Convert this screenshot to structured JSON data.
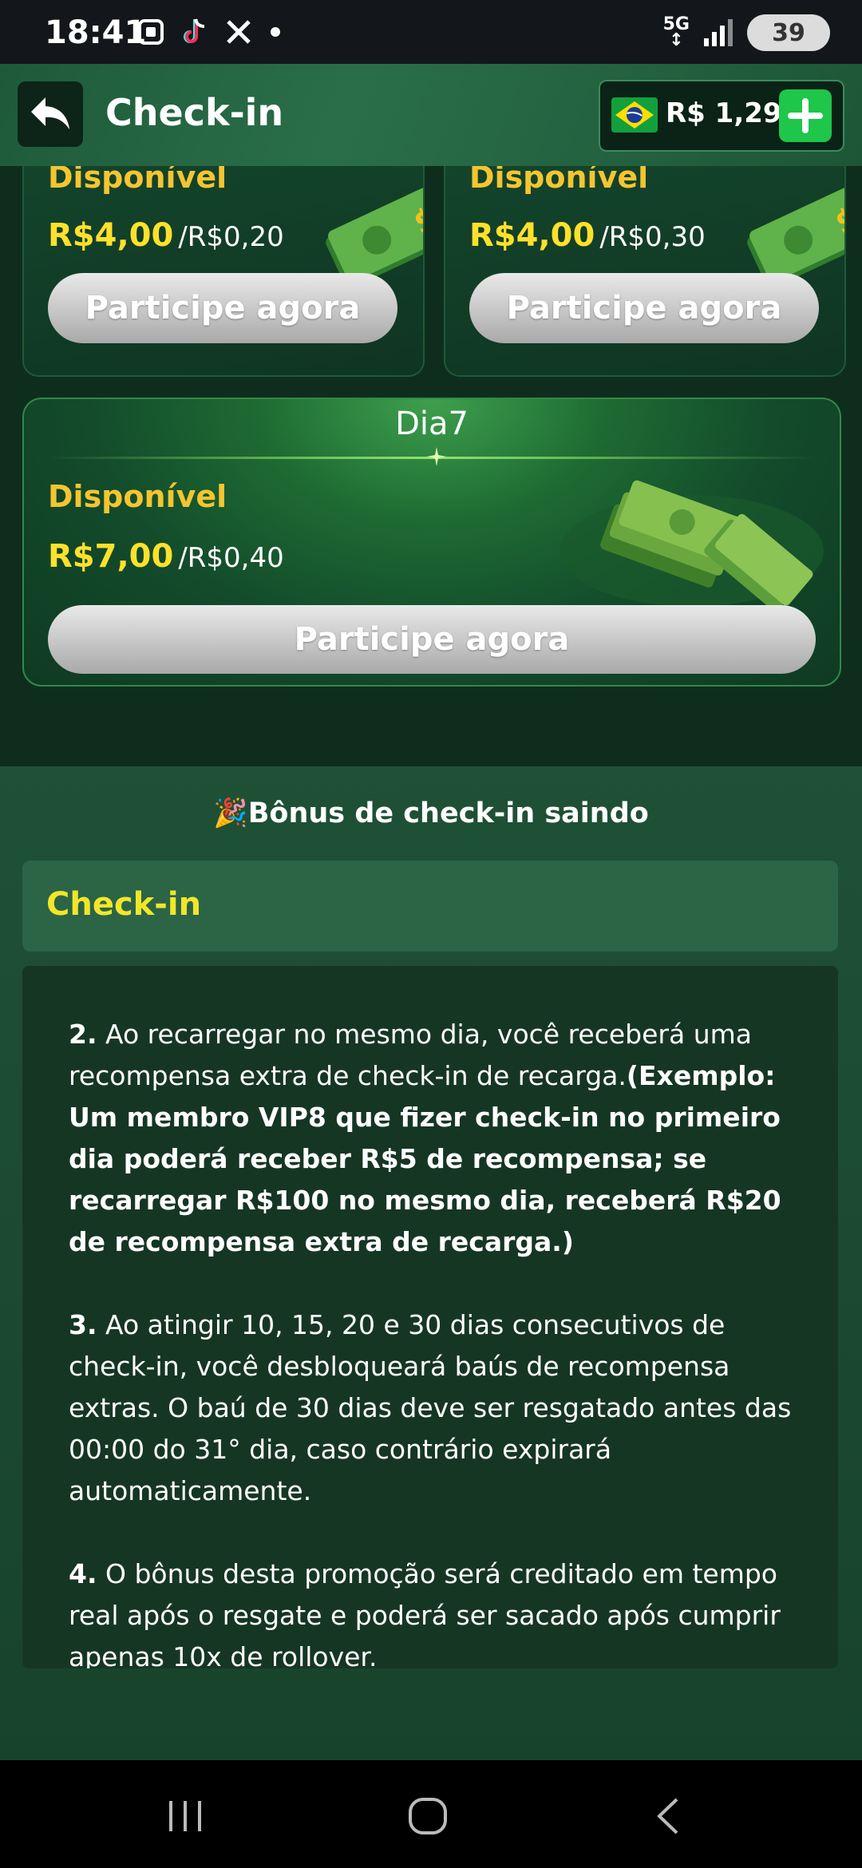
{
  "status_bar": {
    "time": "18:41",
    "network": "5G",
    "battery": "39",
    "left_icons": [
      "screenshot-icon",
      "tiktok-icon",
      "x-icon",
      "dot-icon"
    ]
  },
  "header": {
    "title": "Check-in",
    "back_icon": "back-arrow-icon",
    "wallet_amount": "R$ 1,29",
    "flag_icon": "brazil-flag-icon",
    "add_icon": "plus-icon"
  },
  "cards": {
    "small": [
      {
        "status": "Disponível",
        "amount": "R$4,00",
        "cost": "/R$0,20",
        "button": "Participe agora"
      },
      {
        "status": "Disponível",
        "amount": "R$4,00",
        "cost": "/R$0,30",
        "button": "Participe agora"
      }
    ],
    "day7": {
      "title": "Dia7",
      "status": "Disponível",
      "amount": "R$7,00",
      "cost": "/R$0,40",
      "button": "Participe agora"
    }
  },
  "bonus": {
    "heading": "🎉Bônus de check-in saindo",
    "section_title": "Check-in",
    "rules": {
      "r2_num": "2.",
      "r2_text": " Ao recarregar no mesmo dia, você receberá uma recompensa extra de check-in de recarga.",
      "r2_bold": "(Exemplo: Um membro VIP8 que fizer check-in no primeiro dia poderá receber R$5 de recompensa; se recarregar R$100 no mesmo dia, receberá R$20 de recompensa extra de recarga.)",
      "r3_num": "3.",
      "r3_text": " Ao atingir 10, 15, 20 e 30 dias consecutivos de check-in, você desbloqueará baús de recompensa extras. O baú de 30 dias deve ser resgatado antes das 00:00 do 31° dia, caso contrário expirará automaticamente.",
      "r4_num": "4.",
      "r4_text": " O bônus desta promoção será creditado em tempo real após o resgate e poderá ser sacado após cumprir apenas 10x de rollover."
    }
  },
  "nav_bar": [
    "recent-apps-icon",
    "home-icon",
    "back-icon"
  ]
}
